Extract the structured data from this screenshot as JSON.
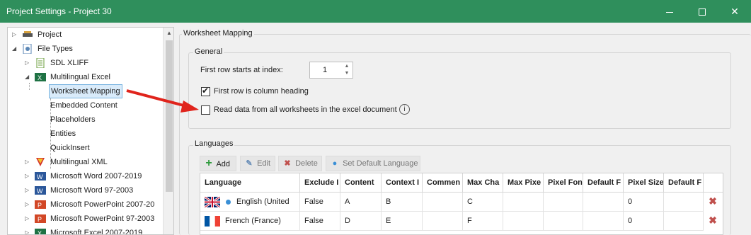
{
  "window": {
    "title": "Project Settings - Project 30",
    "accent": "#2f8f5c"
  },
  "tree": {
    "items": [
      {
        "label": "Project",
        "icon": "project-icon"
      },
      {
        "label": "File Types",
        "icon": "file-types-icon"
      },
      {
        "label": "SDL XLIFF",
        "icon": "xliff-file-icon"
      },
      {
        "label": "Multilingual Excel",
        "icon": "excel-icon"
      },
      {
        "label": "Worksheet Mapping",
        "icon": "",
        "selected": true
      },
      {
        "label": "Embedded Content",
        "icon": ""
      },
      {
        "label": "Placeholders",
        "icon": ""
      },
      {
        "label": "Entities",
        "icon": ""
      },
      {
        "label": "QuickInsert",
        "icon": ""
      },
      {
        "label": "Multilingual XML",
        "icon": "xml-badge-icon"
      },
      {
        "label": "Microsoft Word 2007-2019",
        "icon": "word-icon"
      },
      {
        "label": "Microsoft Word 97-2003",
        "icon": "word-icon"
      },
      {
        "label": "Microsoft PowerPoint 2007-20",
        "icon": "powerpoint-icon"
      },
      {
        "label": "Microsoft PowerPoint 97-2003",
        "icon": "powerpoint-icon"
      },
      {
        "label": "Microsoft Excel 2007-2019",
        "icon": "excel-icon"
      }
    ]
  },
  "panel": {
    "title": "Worksheet Mapping",
    "general": {
      "label": "General",
      "first_row_label": "First row starts at index:",
      "first_row_value": "1",
      "heading_checkbox": {
        "label": "First row is column heading",
        "checked": true
      },
      "all_sheets_checkbox": {
        "label": "Read data from all worksheets in the excel document",
        "checked": false
      }
    },
    "languages": {
      "label": "Languages",
      "toolbar": {
        "add": "Add",
        "edit": "Edit",
        "delete": "Delete",
        "set_default": "Set Default Language"
      },
      "columns": [
        "Language",
        "Exclude I",
        "Content",
        "Context I",
        "Commen",
        "Max Cha",
        "Max Pixe",
        "Pixel Fon",
        "Default F",
        "Pixel Size",
        "Default F"
      ],
      "rows": [
        {
          "language": "English (United",
          "flag": "uk-flag-icon",
          "is_default": true,
          "exclude": "False",
          "content": "A",
          "context": "B",
          "comment": "",
          "max_chars": "C",
          "max_pixels": "",
          "pixel_font": "",
          "default_f": "",
          "pixel_size": "0",
          "default_f2": ""
        },
        {
          "language": "French (France)",
          "flag": "france-flag-icon",
          "is_default": false,
          "exclude": "False",
          "content": "D",
          "context": "E",
          "comment": "",
          "max_chars": "F",
          "max_pixels": "",
          "pixel_font": "",
          "default_f": "",
          "pixel_size": "0",
          "default_f2": ""
        }
      ]
    }
  }
}
